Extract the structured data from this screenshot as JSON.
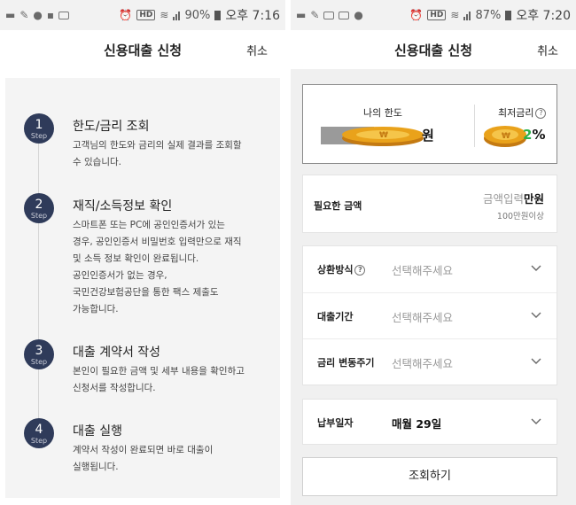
{
  "left": {
    "status": {
      "battery": "90%",
      "time": "오후 7:16"
    },
    "title": "신용대출 신청",
    "cancel": "취소",
    "steps": [
      {
        "num": "1",
        "word": "Step",
        "title": "한도/금리 조회",
        "desc": [
          "고객님의 한도와 금리의 실제 결과를 조회할",
          "수 있습니다."
        ]
      },
      {
        "num": "2",
        "word": "Step",
        "title": "재직/소득정보 확인",
        "desc": [
          "스마트폰 또는 PC에 공인인증서가 있는",
          "경우, 공인인증서 비밀번호 입력만으로 재직",
          "및 소득 정보 확인이 완료됩니다.",
          "공인인증서가 없는 경우,",
          "국민건강보험공단을 통한 팩스 제출도",
          "가능합니다."
        ]
      },
      {
        "num": "3",
        "word": "Step",
        "title": "대출 계약서 작성",
        "desc": [
          "본인이 필요한 금액 및 세부 내용을 확인하고",
          "신청서를 작성합니다."
        ]
      },
      {
        "num": "4",
        "word": "Step",
        "title": "대출 실행",
        "desc": [
          "계약서 작성이 완료되면 바로 대출이",
          "실행됩니다."
        ]
      }
    ]
  },
  "right": {
    "status": {
      "battery": "87%",
      "time": "오후 7:20"
    },
    "title": "신용대출 신청",
    "cancel": "취소",
    "limit": {
      "label": "나의 한도",
      "value_suffix": "원"
    },
    "rate": {
      "label": "최저금리",
      "digit": "2",
      "unit": "%"
    },
    "amount": {
      "label": "필요한 금액",
      "placeholder": "금액입력",
      "unit": "만원",
      "hint": "100만원이상"
    },
    "selects": [
      {
        "label": "상환방식",
        "value": "선택해주세요",
        "has_help": true
      },
      {
        "label": "대출기간",
        "value": "선택해주세요",
        "has_help": false
      },
      {
        "label": "금리 변동주기",
        "value": "선택해주세요",
        "has_help": false
      }
    ],
    "payday": {
      "label": "납부일자",
      "value": "매월 29일"
    },
    "submit": "조회하기"
  },
  "colors": {
    "step_circle": "#2f3b5a",
    "rate_green": "#2ab04a",
    "coin_gold": "#e9a21b"
  },
  "icons": [
    "message-icon",
    "chat-icon",
    "alarm-icon",
    "hd-icon",
    "wifi-icon",
    "signal-icon",
    "battery-icon",
    "chevron-down-icon",
    "help-icon",
    "coin-icon"
  ]
}
